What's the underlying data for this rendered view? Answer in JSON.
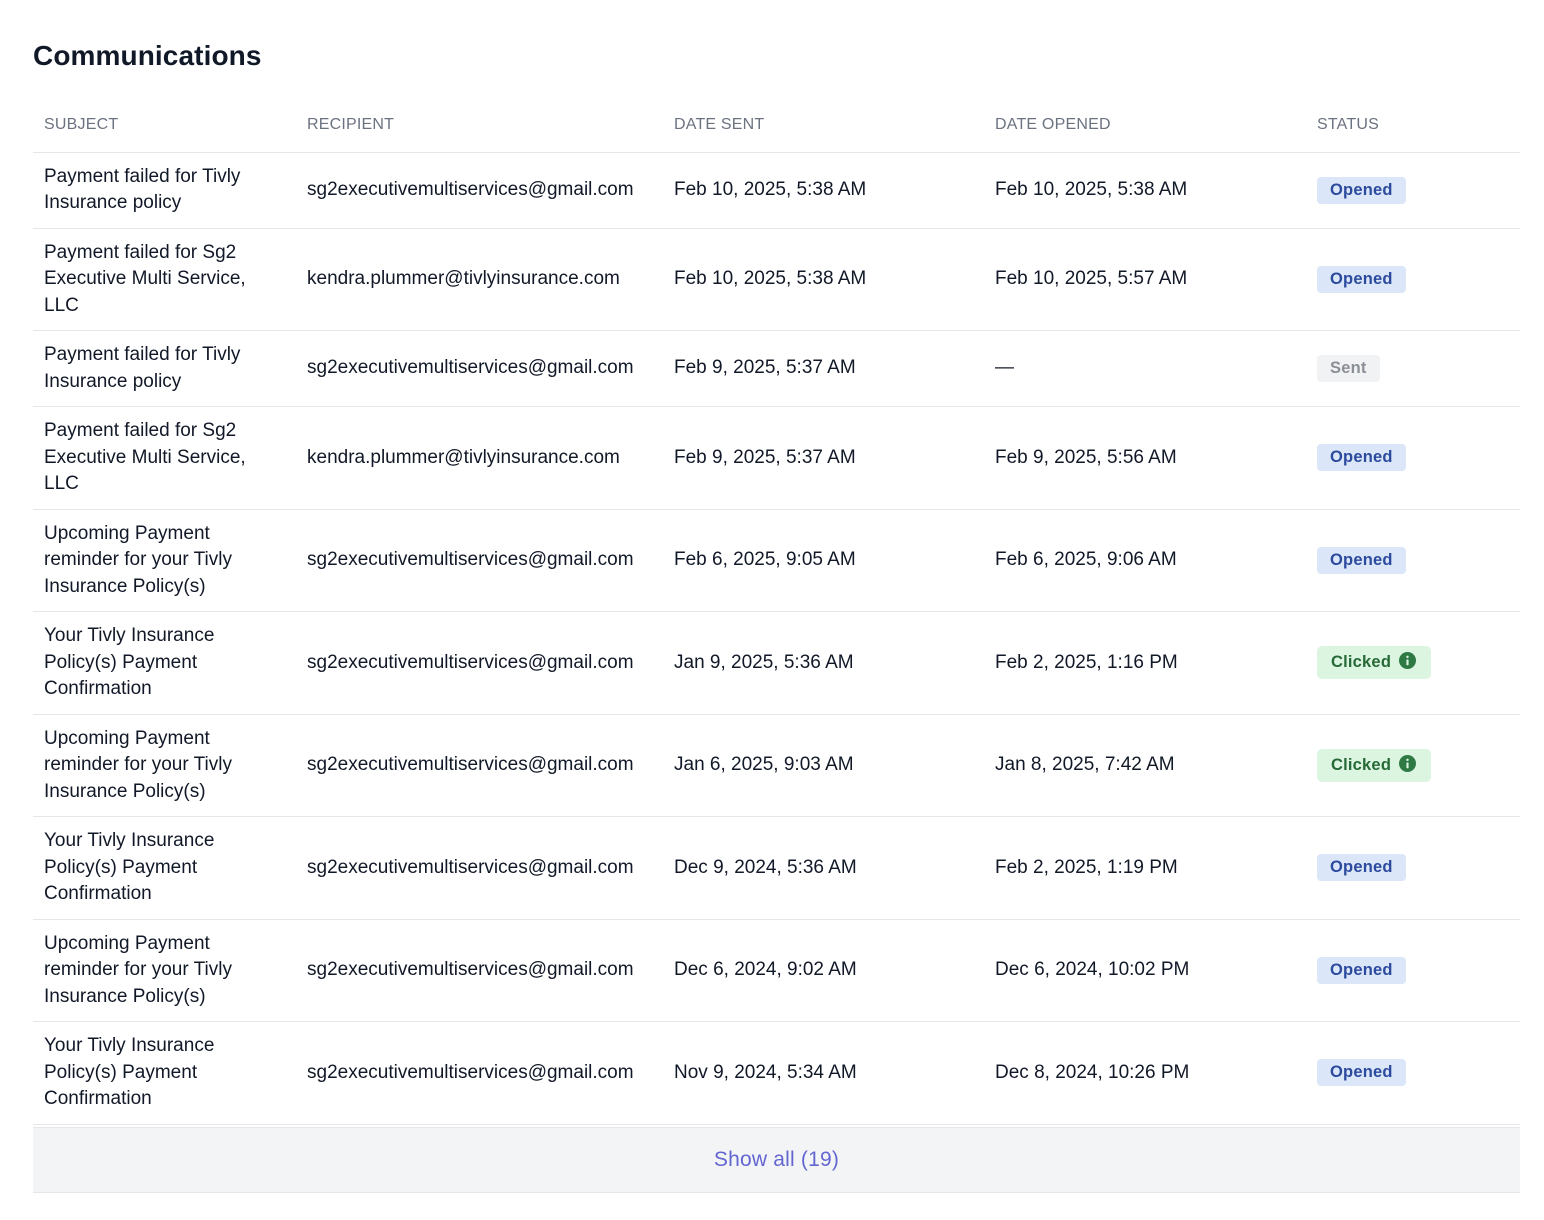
{
  "page": {
    "title": "Communications"
  },
  "table": {
    "headers": {
      "subject": "SUBJECT",
      "recipient": "RECIPIENT",
      "date_sent": "DATE SENT",
      "date_opened": "DATE OPENED",
      "status": "STATUS"
    },
    "rows": [
      {
        "subject": "Payment failed for Tivly Insurance policy",
        "recipient": "sg2executivemultiservices@gmail.com",
        "date_sent": "Feb 10, 2025, 5:38 AM",
        "date_opened": "Feb 10, 2025, 5:38 AM",
        "status": "Opened"
      },
      {
        "subject": "Payment failed for Sg2 Executive Multi Service, LLC",
        "recipient": "kendra.plummer@tivlyinsurance.com",
        "date_sent": "Feb 10, 2025, 5:38 AM",
        "date_opened": "Feb 10, 2025, 5:57 AM",
        "status": "Opened"
      },
      {
        "subject": "Payment failed for Tivly Insurance policy",
        "recipient": "sg2executivemultiservices@gmail.com",
        "date_sent": "Feb 9, 2025, 5:37 AM",
        "date_opened": "—",
        "status": "Sent"
      },
      {
        "subject": "Payment failed for Sg2 Executive Multi Service, LLC",
        "recipient": "kendra.plummer@tivlyinsurance.com",
        "date_sent": "Feb 9, 2025, 5:37 AM",
        "date_opened": "Feb 9, 2025, 5:56 AM",
        "status": "Opened"
      },
      {
        "subject": "Upcoming Payment reminder for your Tivly Insurance Policy(s)",
        "recipient": "sg2executivemultiservices@gmail.com",
        "date_sent": "Feb 6, 2025, 9:05 AM",
        "date_opened": "Feb 6, 2025, 9:06 AM",
        "status": "Opened"
      },
      {
        "subject": "Your Tivly Insurance Policy(s) Payment Confirmation",
        "recipient": "sg2executivemultiservices@gmail.com",
        "date_sent": "Jan 9, 2025, 5:36 AM",
        "date_opened": "Feb 2, 2025, 1:16 PM",
        "status": "Clicked"
      },
      {
        "subject": "Upcoming Payment reminder for your Tivly Insurance Policy(s)",
        "recipient": "sg2executivemultiservices@gmail.com",
        "date_sent": "Jan 6, 2025, 9:03 AM",
        "date_opened": "Jan 8, 2025, 7:42 AM",
        "status": "Clicked"
      },
      {
        "subject": "Your Tivly Insurance Policy(s) Payment Confirmation",
        "recipient": "sg2executivemultiservices@gmail.com",
        "date_sent": "Dec 9, 2024, 5:36 AM",
        "date_opened": "Feb 2, 2025, 1:19 PM",
        "status": "Opened"
      },
      {
        "subject": "Upcoming Payment reminder for your Tivly Insurance Policy(s)",
        "recipient": "sg2executivemultiservices@gmail.com",
        "date_sent": "Dec 6, 2024, 9:02 AM",
        "date_opened": "Dec 6, 2024, 10:02 PM",
        "status": "Opened"
      },
      {
        "subject": "Your Tivly Insurance Policy(s) Payment Confirmation",
        "recipient": "sg2executivemultiservices@gmail.com",
        "date_sent": "Nov 9, 2024, 5:34 AM",
        "date_opened": "Dec 8, 2024, 10:26 PM",
        "status": "Opened"
      }
    ]
  },
  "status_styles": {
    "Opened": {
      "bg": "#dbe7f8",
      "fg": "#2c4a9e",
      "icon": null
    },
    "Sent": {
      "bg": "#f1f2f4",
      "fg": "#8b8f96",
      "icon": null
    },
    "Clicked": {
      "bg": "#dcf5e1",
      "fg": "#276a38",
      "icon": "info-icon"
    }
  },
  "footer": {
    "show_all_label": "Show all (19)"
  }
}
